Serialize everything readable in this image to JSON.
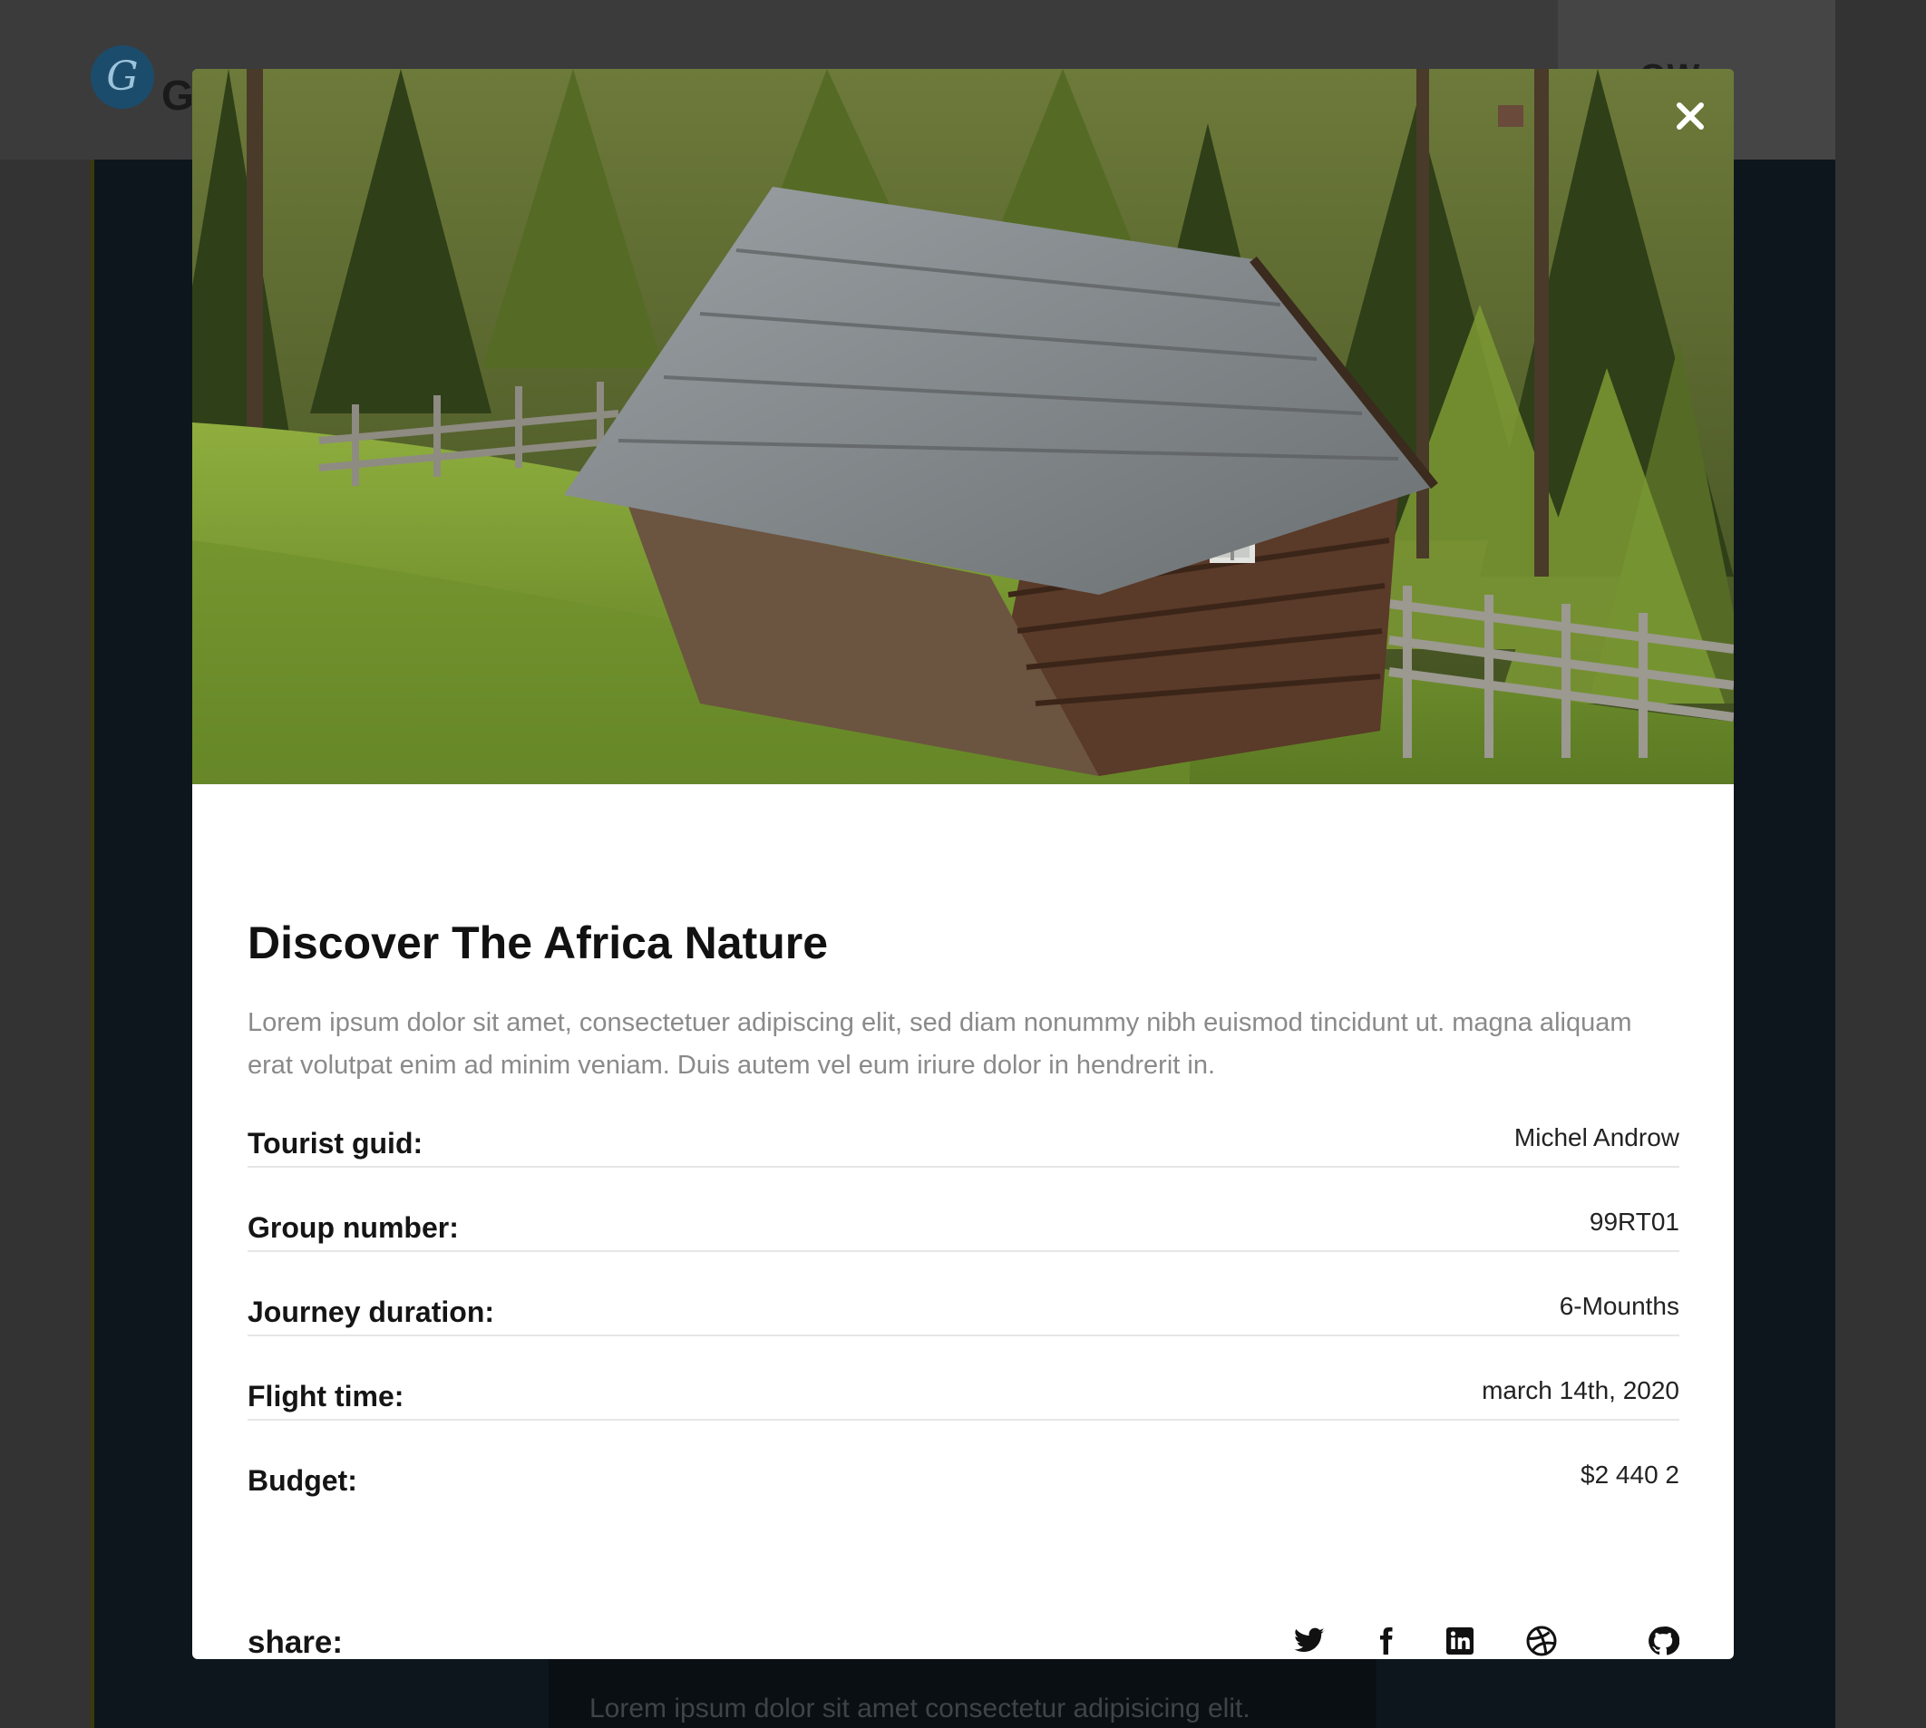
{
  "background": {
    "logo_glyph": "G",
    "brand_letter": "G",
    "cta_label_partial": "OW",
    "hero_text": "Lorem ipsum dolor sit amet consectetur adipisicing elit."
  },
  "modal": {
    "image_alt": "Wooden cabin on a grassy hillside in a forest",
    "close_icon": "close-icon",
    "title": "Discover The Africa Nature",
    "description": "Lorem ipsum dolor sit amet, consectetuer adipiscing elit, sed diam nonummy nibh euismod tincidunt ut. magna aliquam erat volutpat enim ad minim veniam. Duis autem vel eum iriure dolor in hendrerit in.",
    "details": [
      {
        "label": "Tourist guid:",
        "value": "Michel Androw"
      },
      {
        "label": "Group number:",
        "value": "99RT01"
      },
      {
        "label": "Journey duration:",
        "value": "6-Mounths"
      },
      {
        "label": "Flight time:",
        "value": "march 14th, 2020"
      },
      {
        "label": "Budget:",
        "value": "$2 440 2"
      }
    ],
    "share": {
      "label": "share:",
      "icons": [
        "twitter-icon",
        "facebook-icon",
        "linkedin-icon",
        "dribbble-icon",
        "github-icon"
      ]
    }
  },
  "colors": {
    "overlay": "#333333",
    "modal_background": "#ffffff",
    "title": "#111111",
    "description": "#8a8a8a",
    "divider": "#e6e6e6"
  }
}
